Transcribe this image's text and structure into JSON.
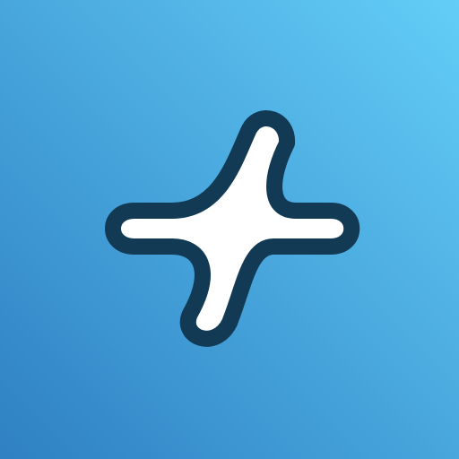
{
  "icon": {
    "name": "sparkle-icon",
    "fill": "#ffffff",
    "outline": "#123a55"
  },
  "background": {
    "top_right": "#63cdf7",
    "bottom_left": "#2e80c2"
  }
}
